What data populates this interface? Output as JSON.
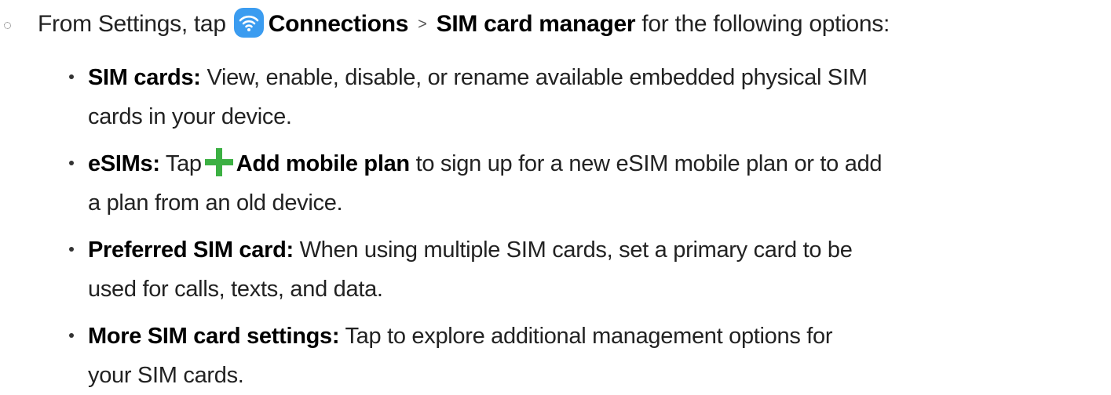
{
  "intro": {
    "prefix": "From Settings, tap",
    "icon": "wifi-icon",
    "connections": "Connections",
    "separator": ">",
    "sim_manager": "SIM card manager",
    "suffix": "for the following options:"
  },
  "options": [
    {
      "term": "SIM cards:",
      "line1": "View, enable, disable, or rename available embedded physical SIM",
      "line2": "cards in your device."
    },
    {
      "term": "eSIMs:",
      "pre": "Tap",
      "icon": "plus-icon",
      "action": "Add mobile plan",
      "line1": "to sign up for a new eSIM mobile plan or to add",
      "line2": "a plan from an old device."
    },
    {
      "term": "Preferred SIM card:",
      "line1": "When using multiple SIM cards, set a primary card to be",
      "line2": "used for calls, texts, and data."
    },
    {
      "term": "More SIM card settings:",
      "line1": "Tap to explore additional management options for",
      "line2": "your SIM cards."
    }
  ],
  "colors": {
    "wifi_icon_bg": "#3b9cf0",
    "plus_icon": "#3cb043",
    "text": "#222222"
  }
}
